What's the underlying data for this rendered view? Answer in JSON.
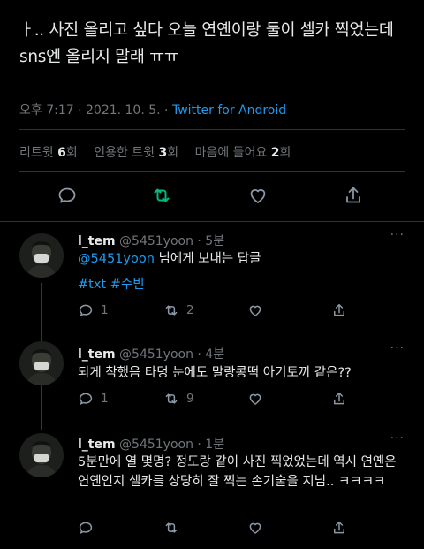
{
  "tweet": {
    "text": "ㅏ.. 사진 올리고 싶다 오늘 연옌이랑 둘이 셀카 찍었는데 sns엔 올리지 말래 ㅠㅠ",
    "timestamp": "오후 7:17 · 2021. 10. 5. · ",
    "source": "Twitter for Android",
    "stats": {
      "retweets_label": "리트윗 ",
      "retweets_count": "6",
      "retweets_unit": "회",
      "quotes_label": "인용한 트윗 ",
      "quotes_count": "3",
      "quotes_unit": "회",
      "likes_label": "마음에 들어요 ",
      "likes_count": "2",
      "likes_unit": "회"
    },
    "actions": [
      "reply-icon",
      "retweet-icon",
      "like-icon",
      "share-icon"
    ],
    "retweet_color": "#00ba7c"
  },
  "replies": [
    {
      "name": "l_tem",
      "handle": "@5451yoon · 5분",
      "mention": "@5451yoon",
      "mention_suffix": " 님에게 보내는 답글",
      "hashtags": "#txt #수빈",
      "reply_count": "1",
      "retweet_count": "2",
      "more": "···"
    },
    {
      "name": "l_tem",
      "handle": "@5451yoon · 4분",
      "text": "되게 착했음 타덩 눈에도 말랑콩떡 아기토끼 같은??",
      "reply_count": "1",
      "retweet_count": "9",
      "more": "···"
    },
    {
      "name": "l_tem",
      "handle": "@5451yoon · 1분",
      "text": "5분만에 열 몇명? 정도랑 같이 사진 찍었었는데 역시 연옌은 연옌인지 셀카를 상당히 잘 찍는 손기술을 지님.. ㅋㅋㅋㅋ",
      "more": "···"
    }
  ],
  "colors": {
    "link": "#1d9bf0",
    "muted": "#71767b",
    "text": "#e7e9ea"
  }
}
